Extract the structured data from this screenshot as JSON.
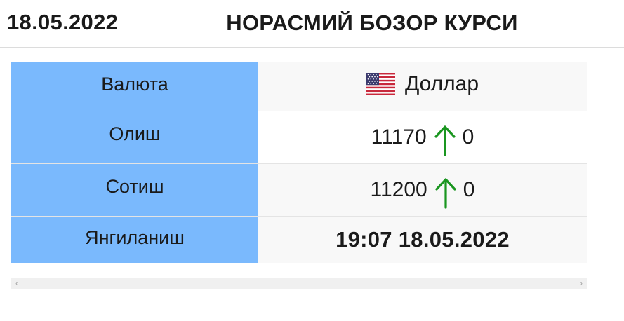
{
  "header": {
    "date": "18.05.2022",
    "title": "НОРАСМИЙ БОЗОР КУРСИ"
  },
  "table": {
    "currency_label": "Валюта",
    "currency_name": "Доллар",
    "currency_flag_icon": "us-flag-icon",
    "buy_label": "Олиш",
    "buy_value": "11170",
    "buy_change": "0",
    "sell_label": "Сотиш",
    "sell_value": "11200",
    "sell_change": "0",
    "updated_label": "Янгиланиш",
    "updated_value": "19:07 18.05.2022"
  },
  "icons": {
    "change_arrow": "arrow-up-icon",
    "scroll_left": "chevron-left-icon",
    "scroll_right": "chevron-right-icon"
  },
  "colors": {
    "label_bg": "#7ab9fd",
    "arrow_up": "#1a9620",
    "row_alt_bg": "#f8f8f8"
  }
}
